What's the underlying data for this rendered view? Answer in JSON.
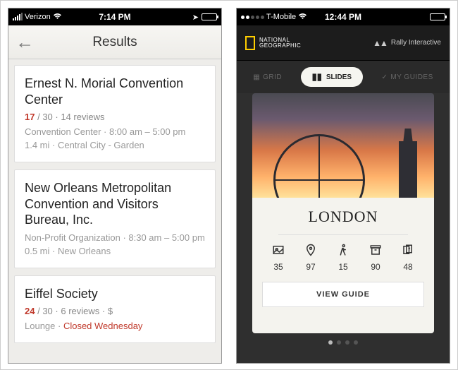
{
  "left": {
    "statusbar": {
      "carrier": "Verizon",
      "time": "7:14 PM"
    },
    "navbar": {
      "title": "Results"
    },
    "results": [
      {
        "title": "Ernest N. Morial Convention Center",
        "rating_num": "17",
        "rating_den": "/ 30",
        "reviews": "14 reviews",
        "price": "",
        "line2": "Convention Center · 8:00 am – 5:00 pm",
        "line3": "1.4 mi · Central City - Garden",
        "closed": ""
      },
      {
        "title": "New Orleans Metropolitan Convention and Visitors Bureau, Inc.",
        "rating_num": "",
        "rating_den": "",
        "reviews": "",
        "price": "",
        "line2": "Non-Profit Organization · 8:30 am – 5:00 pm",
        "line3": "0.5 mi · New Orleans",
        "closed": ""
      },
      {
        "title": "Eiffel Society",
        "rating_num": "24",
        "rating_den": "/ 30",
        "reviews": "6 reviews",
        "price": "$",
        "line2": "Lounge · ",
        "line3": "",
        "closed": "Closed Wednesday"
      }
    ]
  },
  "right": {
    "statusbar": {
      "carrier": "T-Mobile",
      "time": "12:44 PM"
    },
    "header": {
      "brand_top": "NATIONAL",
      "brand_bottom": "GEOGRAPHIC",
      "partner": "Rally Interactive"
    },
    "tabs": {
      "grid": "GRID",
      "slides": "SLIDES",
      "myguides": "MY GUIDES"
    },
    "slide": {
      "title": "LONDON",
      "stats": [
        {
          "value": "35"
        },
        {
          "value": "97"
        },
        {
          "value": "15"
        },
        {
          "value": "90"
        },
        {
          "value": "48"
        }
      ],
      "cta": "VIEW GUIDE"
    }
  }
}
